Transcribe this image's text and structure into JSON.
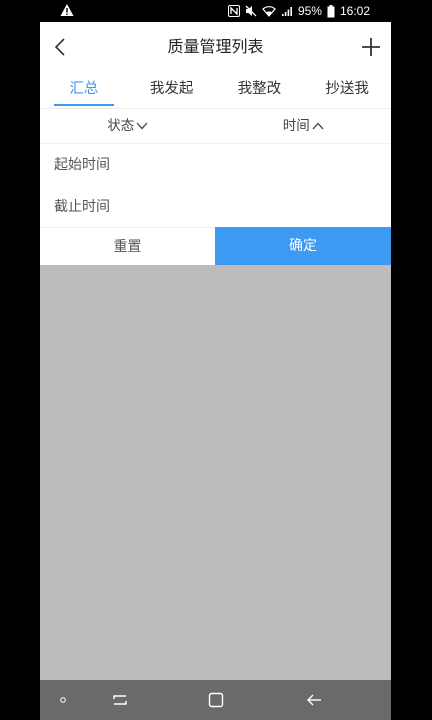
{
  "status_bar": {
    "battery_percent": "95%",
    "time": "16:02",
    "icons": [
      "warning-icon",
      "nfc-icon",
      "mute-icon",
      "wifi-icon",
      "signal-icon",
      "battery-icon"
    ]
  },
  "header": {
    "title": "质量管理列表",
    "back_icon": "chevron-left-icon",
    "add_icon": "plus-icon"
  },
  "tabs": [
    {
      "label": "汇总",
      "active": true
    },
    {
      "label": "我发起",
      "active": false
    },
    {
      "label": "我整改",
      "active": false
    },
    {
      "label": "抄送我",
      "active": false
    }
  ],
  "filters": {
    "status_label": "状态",
    "status_icon": "chevron-down-icon",
    "time_label": "时间",
    "time_icon": "chevron-up-icon"
  },
  "date_fields": {
    "start_label": "起始时间",
    "end_label": "截止时间"
  },
  "actions": {
    "reset_label": "重置",
    "confirm_label": "确定"
  },
  "colors": {
    "accent": "#3d97f0",
    "overlay": "#bdbcbb",
    "nav_bar": "#6a6a6a"
  },
  "nav_bar": {
    "icons": [
      "dot-icon",
      "recent-apps-icon",
      "home-icon",
      "back-arrow-icon"
    ]
  }
}
